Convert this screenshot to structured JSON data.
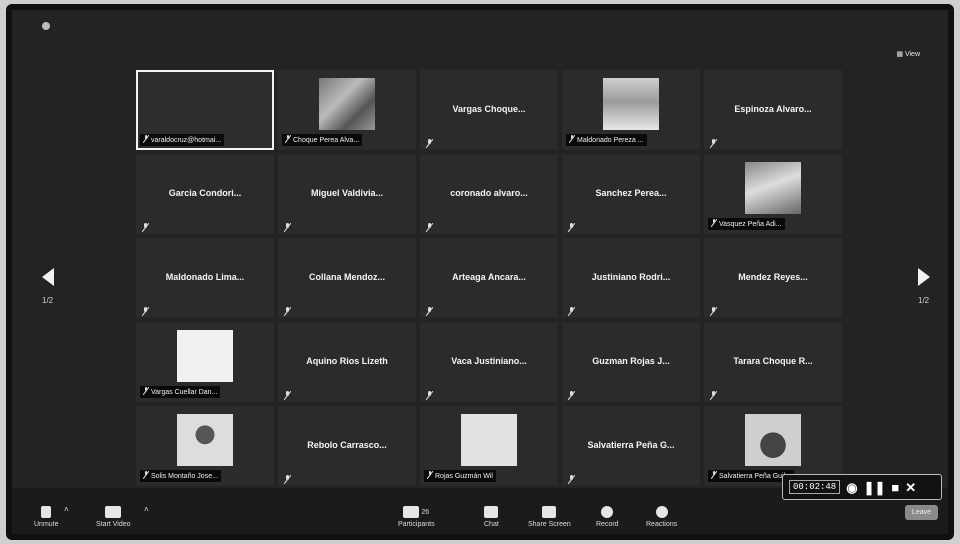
{
  "view_label": "View",
  "pagination": {
    "left": "1/2",
    "right": "1/2"
  },
  "participants": [
    {
      "name": "",
      "label": "varaldocruz@hotmai...",
      "avatar": "",
      "active": true
    },
    {
      "name": "",
      "label": "Choque Perea Alva...",
      "avatar": "photo1"
    },
    {
      "name": "Vargas Choque...",
      "label": "",
      "avatar": ""
    },
    {
      "name": "",
      "label": "Maldonado Pereza ...",
      "avatar": "flag"
    },
    {
      "name": "Espinoza Alvaro...",
      "label": "",
      "avatar": ""
    },
    {
      "name": "Garcia Condori...",
      "label": "",
      "avatar": ""
    },
    {
      "name": "Miguel Valdivia...",
      "label": "",
      "avatar": ""
    },
    {
      "name": "coronado alvaro...",
      "label": "",
      "avatar": ""
    },
    {
      "name": "Sanchez Perea...",
      "label": "",
      "avatar": ""
    },
    {
      "name": "",
      "label": "Vasquez Peña Adi...",
      "avatar": "photo2"
    },
    {
      "name": "Maldonado Lima...",
      "label": "",
      "avatar": ""
    },
    {
      "name": "Collana Mendoz...",
      "label": "",
      "avatar": ""
    },
    {
      "name": "Arteaga Ancara...",
      "label": "",
      "avatar": ""
    },
    {
      "name": "Justiniano Rodri...",
      "label": "",
      "avatar": ""
    },
    {
      "name": "Mendez Reyes...",
      "label": "",
      "avatar": ""
    },
    {
      "name": "",
      "label": "Vargas Cuellar Dan...",
      "avatar": "white"
    },
    {
      "name": "Aquino Rios Lizeth",
      "label": "",
      "avatar": ""
    },
    {
      "name": "Vaca Justiniano...",
      "label": "",
      "avatar": ""
    },
    {
      "name": "Guzman Rojas J...",
      "label": "",
      "avatar": ""
    },
    {
      "name": "Tarara Choque R...",
      "label": "",
      "avatar": ""
    },
    {
      "name": "",
      "label": "Solis Montaño Jose...",
      "avatar": "face"
    },
    {
      "name": "Rebolo Carrasco...",
      "label": "",
      "avatar": ""
    },
    {
      "name": "",
      "label": "Rojas Guzmán Wil",
      "avatar": "blank"
    },
    {
      "name": "Salvatierra Peña G...",
      "label": "",
      "avatar": ""
    },
    {
      "name": "",
      "label": "Salvatierra Peña Guil...",
      "avatar": "bird"
    }
  ],
  "toolbar": {
    "unmute": "Unmute",
    "start_video": "Start Video",
    "participants": "Participants",
    "participants_count": "26",
    "chat": "Chat",
    "share_screen": "Share Screen",
    "record": "Record",
    "reactions": "Reactions",
    "leave": "Leave"
  },
  "recorder": {
    "time": "00:02:48"
  }
}
